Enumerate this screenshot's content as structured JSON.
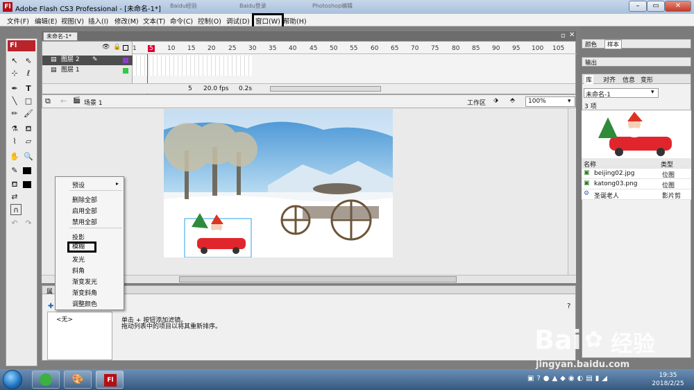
{
  "window": {
    "title": "Adobe Flash CS3 Professional - [未命名-1*]",
    "ghost_tabs": [
      "Baidu经验",
      "Baidu登录",
      "Photoshop编辑"
    ]
  },
  "menu": [
    "文件(F)",
    "编辑(E)",
    "视图(V)",
    "插入(I)",
    "修改(M)",
    "文本(T)",
    "命令(C)",
    "控制(O)",
    "调试(D)",
    "窗口(W)",
    "帮助(H)"
  ],
  "document": {
    "tab": "未命名-1*",
    "scene": "场景 1",
    "workspace": "工作区",
    "zoom": "100%"
  },
  "timeline": {
    "frames": [
      "1",
      "5",
      "10",
      "15",
      "20",
      "25",
      "30",
      "35",
      "40",
      "45",
      "50",
      "55",
      "60",
      "65",
      "70",
      "75",
      "80",
      "85",
      "90",
      "95",
      "100",
      "105"
    ],
    "layers": [
      "图层 2",
      "图层 1"
    ],
    "current_frame": "5",
    "fps": "20.0 fps",
    "time": "0.2s"
  },
  "tools": {
    "logo": "Fl"
  },
  "context_menu": {
    "items": [
      "预设",
      "删除全部",
      "启用全部",
      "禁用全部",
      "投影",
      "模糊",
      "发光",
      "斜角",
      "渐变发光",
      "渐变斜角",
      "调整颜色"
    ],
    "highlighted": "模糊"
  },
  "properties": {
    "filter_list": "<无>",
    "hint1": "单击 + 按钮添加滤镜。",
    "hint2": "拖动列表中的项目以将其重新排序。",
    "tab": "属"
  },
  "right_panels": {
    "top_tabs": [
      "颜色",
      "样本"
    ],
    "output": "输出",
    "lib_tabs": [
      "库",
      "对齐",
      "信息",
      "变形"
    ],
    "lib_doc": "未命名-1",
    "count": "3 项",
    "col_name": "名称",
    "col_type": "类型",
    "items": [
      {
        "name": "beijing02.jpg",
        "type": "位图"
      },
      {
        "name": "katong03.png",
        "type": "位图"
      },
      {
        "name": "圣诞老人",
        "type": "影片剪"
      }
    ]
  },
  "taskbar": {
    "time": "19:35",
    "date": "2018/2/25",
    "flash_btn": "Fl"
  },
  "watermark": {
    "brand": "Bai",
    "brand2": "经验",
    "url": "jingyan.baidu.com"
  }
}
